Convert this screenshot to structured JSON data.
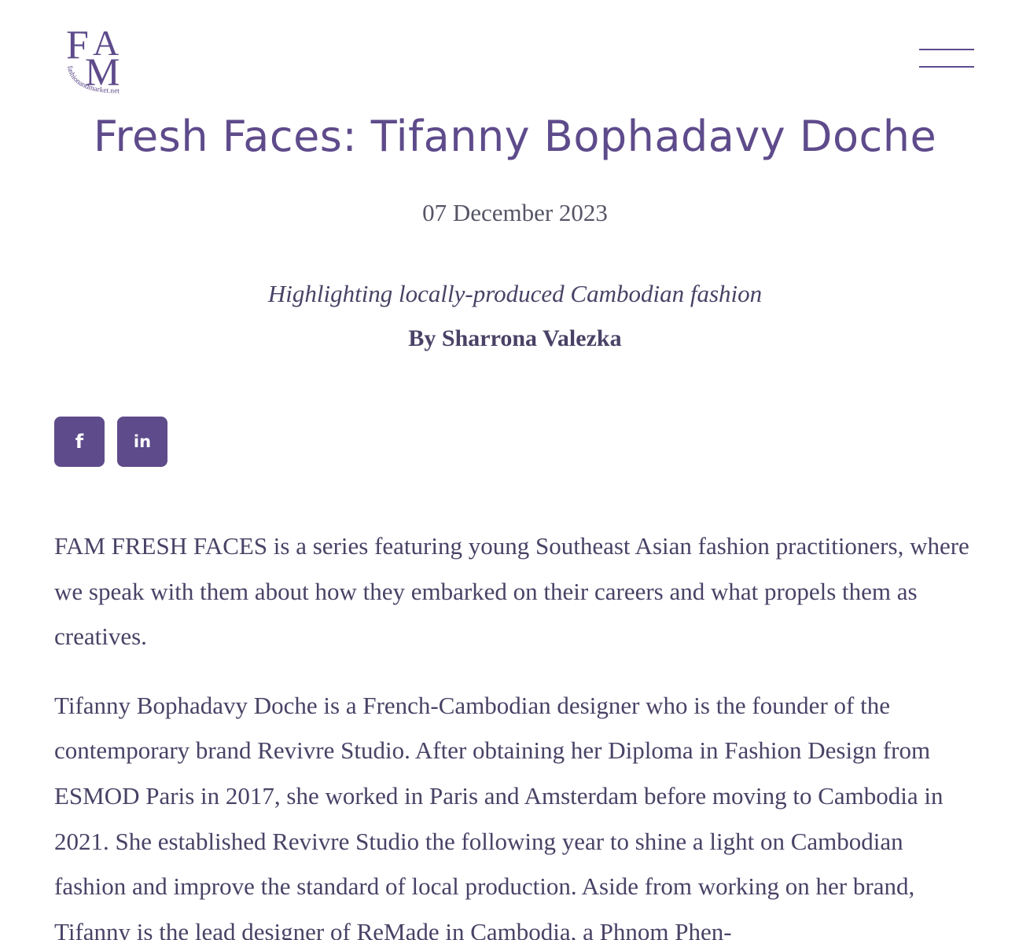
{
  "header": {
    "logo_text": "FAM",
    "logo_subtext": "fashionandmarket.net",
    "menu_icon": "hamburger-menu-icon"
  },
  "article": {
    "title": "Fresh Faces: Tifanny Bophadavy Doche",
    "date": "07 December 2023",
    "subtitle": "Highlighting locally-produced Cambodian fashion",
    "byline": "By Sharrona Valezka",
    "paragraphs": [
      "FAM FRESH FACES is a series featuring young Southeast Asian fashion practitioners, where we speak with them about how they embarked on their careers and what propels them as creatives.",
      "Tifanny Bophadavy Doche is a French-Cambodian designer who is the founder of the contemporary brand Revivre Studio. After obtaining her Diploma in Fashion Design from ESMOD Paris in 2017, she worked in Paris and Amsterdam before moving to Cambodia in 2021. She established Revivre Studio the following year to shine a light on Cambodian fashion and improve the standard of local production. Aside from working on her brand, Tifanny is the lead designer of ReMade in Cambodia, a Phnom Phen-"
    ]
  },
  "share": {
    "facebook_glyph": "f",
    "linkedin_glyph": "in"
  },
  "colors": {
    "accent": "#5e4b8b",
    "text": "#4a4266",
    "date": "#555566",
    "background": "#ffffff"
  }
}
